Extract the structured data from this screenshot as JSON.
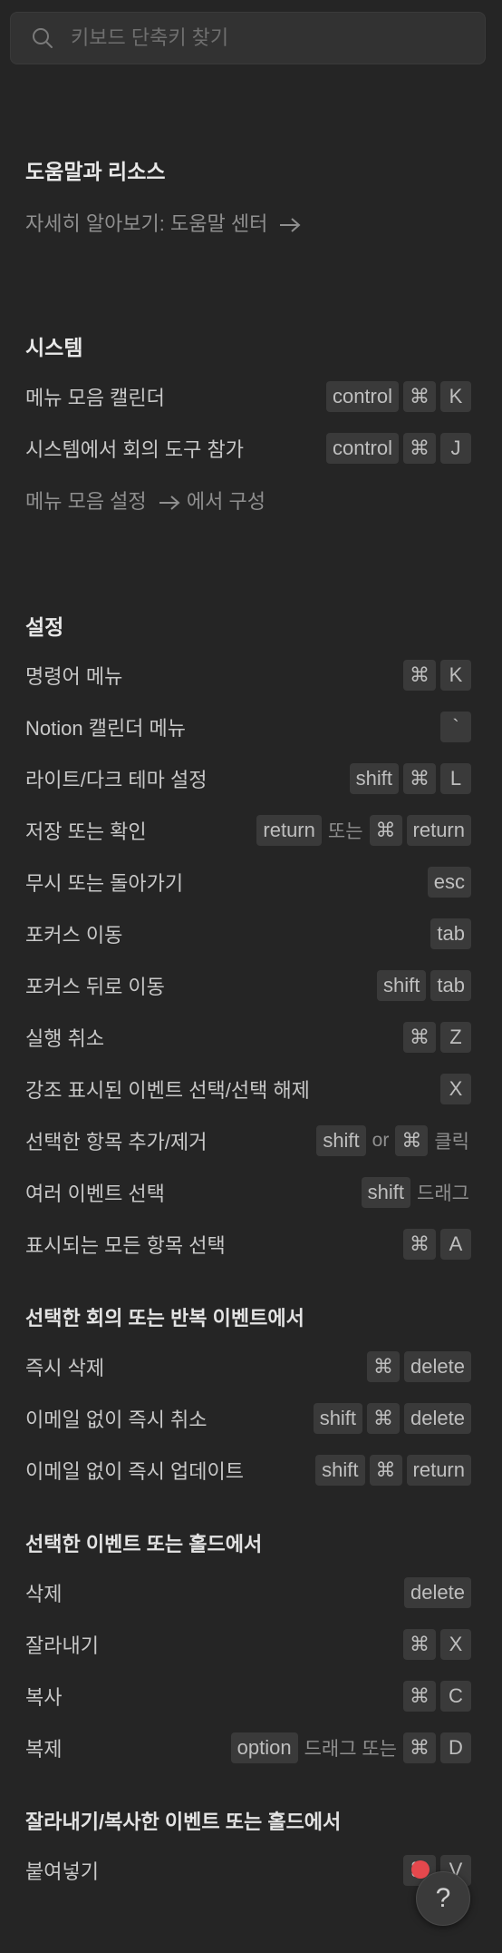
{
  "search": {
    "placeholder": "키보드 단축키 찾기"
  },
  "help": {
    "title": "도움말과 리소스",
    "link": "자세히 알아보기: 도움말 센터"
  },
  "system": {
    "title": "시스템",
    "rows": [
      {
        "label": "메뉴 모음 캘린더",
        "keys": [
          "control",
          "⌘",
          "K"
        ]
      },
      {
        "label": "시스템에서 회의 도구 참가",
        "keys": [
          "control",
          "⌘",
          "J"
        ]
      }
    ],
    "config_link": "메뉴 모음 설정",
    "config_suffix": "에서 구성"
  },
  "settings": {
    "title": "설정",
    "rows": [
      {
        "label": "명령어 메뉴",
        "keys": [
          "⌘",
          "K"
        ]
      },
      {
        "label": "Notion 캘린더 메뉴",
        "keys": [
          "`"
        ]
      },
      {
        "label": "라이트/다크 테마 설정",
        "keys": [
          "shift",
          "⌘",
          "L"
        ]
      },
      {
        "label": "저장 또는 확인",
        "keys": [
          "return"
        ],
        "sep": "또는",
        "keys2": [
          "⌘",
          "return"
        ]
      },
      {
        "label": "무시 또는 돌아가기",
        "keys": [
          "esc"
        ]
      },
      {
        "label": "포커스 이동",
        "keys": [
          "tab"
        ]
      },
      {
        "label": "포커스 뒤로 이동",
        "keys": [
          "shift",
          "tab"
        ]
      },
      {
        "label": "실행 취소",
        "keys": [
          "⌘",
          "Z"
        ]
      },
      {
        "label": "강조 표시된 이벤트 선택/선택 해제",
        "keys": [
          "X"
        ]
      },
      {
        "label": "선택한 항목 추가/제거",
        "keys": [
          "shift"
        ],
        "sep": "or",
        "keys2": [
          "⌘"
        ],
        "suffix": "클릭"
      },
      {
        "label": "여러 이벤트 선택",
        "keys": [
          "shift"
        ],
        "suffix": "드래그"
      },
      {
        "label": "표시되는 모든 항목 선택",
        "keys": [
          "⌘",
          "A"
        ]
      }
    ]
  },
  "meeting": {
    "title": "선택한 회의 또는 반복 이벤트에서",
    "rows": [
      {
        "label": "즉시 삭제",
        "keys": [
          "⌘",
          "delete"
        ]
      },
      {
        "label": "이메일 없이 즉시 취소",
        "keys": [
          "shift",
          "⌘",
          "delete"
        ]
      },
      {
        "label": "이메일 없이 즉시 업데이트",
        "keys": [
          "shift",
          "⌘",
          "return"
        ]
      }
    ]
  },
  "event": {
    "title": "선택한 이벤트 또는 홀드에서",
    "rows": [
      {
        "label": "삭제",
        "keys": [
          "delete"
        ]
      },
      {
        "label": "잘라내기",
        "keys": [
          "⌘",
          "X"
        ]
      },
      {
        "label": "복사",
        "keys": [
          "⌘",
          "C"
        ]
      },
      {
        "label": "복제",
        "keys": [
          "option"
        ],
        "sep": "드래그 또는",
        "keys2": [
          "⌘",
          "D"
        ]
      }
    ]
  },
  "paste": {
    "title": "잘라내기/복사한 이벤트 또는 홀드에서",
    "rows": [
      {
        "label": "붙여넣기",
        "keys": [
          "⌘",
          "V"
        ]
      }
    ]
  },
  "help_button": {
    "label": "?"
  },
  "colors": {
    "background": "#252525",
    "key_bg": "#3a3a3a",
    "badge": "#e5484d"
  }
}
